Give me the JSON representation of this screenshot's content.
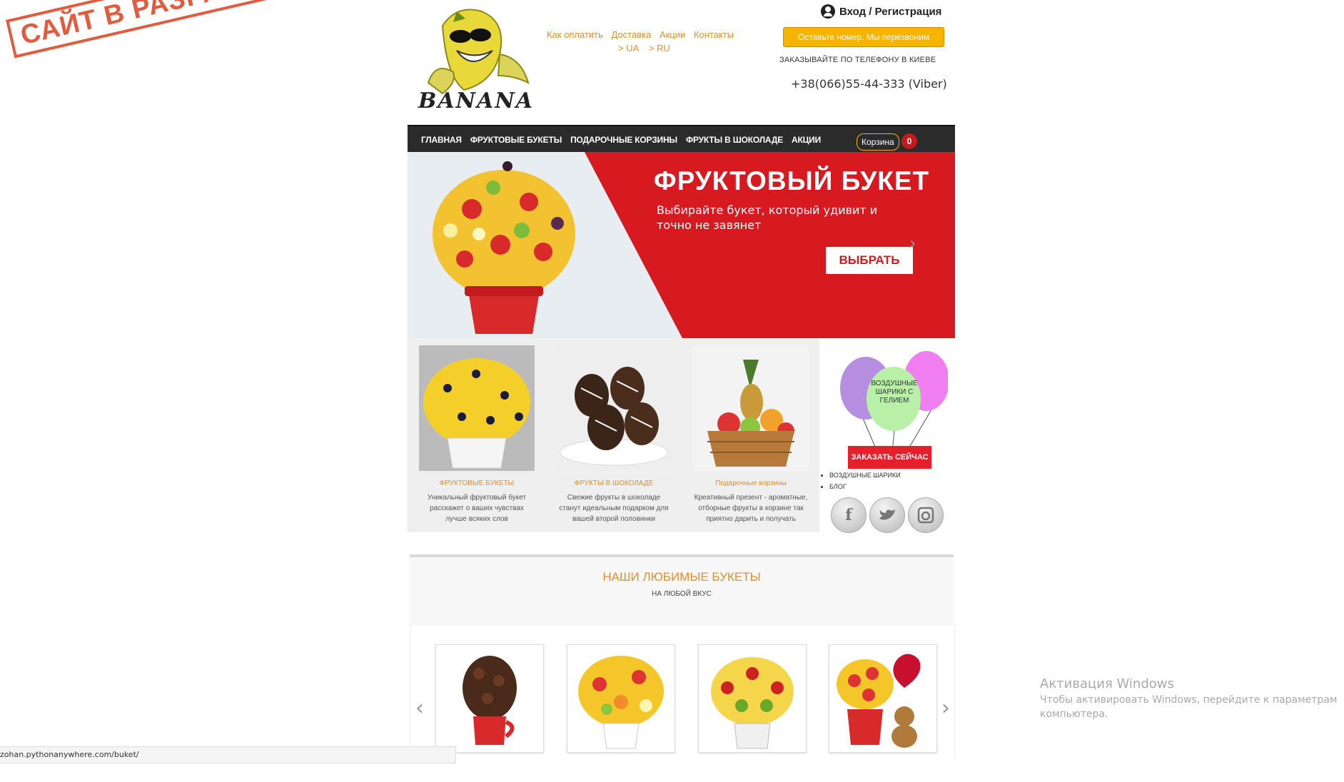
{
  "stamp": "САЙТ В РАЗРАБОТКЕ!",
  "logo": {
    "text": "BANANA"
  },
  "top_links": [
    "Как оплатить",
    "Доставка",
    "Акции",
    "Контакты"
  ],
  "lang_links": [
    "> UA",
    "> RU"
  ],
  "login": {
    "label": "Вход / Регистрация",
    "icon": "user-icon"
  },
  "callback_button": "Оставьте номер. Мы перезвоним",
  "phone_note": "ЗАКАЗЫВАЙТЕ ПО ТЕЛЕФОНУ В КИЕВЕ",
  "phone": "+38(066)55-44-333 (Viber)",
  "nav": {
    "items": [
      "ГЛАВНАЯ",
      "ФРУКТОВЫЕ БУКЕТЫ",
      "ПОДАРОЧНЫЕ КОРЗИНЫ",
      "ФРУКТЫ В ШОКОЛАДЕ",
      "АКЦИИ"
    ],
    "cart_label": "Корзина",
    "cart_count": "0"
  },
  "hero": {
    "title": "ФРУКТОВЫЙ БУКЕТ",
    "subtitle": "Выбирайте букет, который удивит и точно не завянет",
    "button": "ВЫБРАТЬ"
  },
  "categories": [
    {
      "title": "ФРУКТОВЫЕ БУКЕТЫ",
      "desc": "Уникальный фруктовый букет расскажет о ваших чувствах лучше всяких слов"
    },
    {
      "title": "ФРУКТЫ В ШОКОЛАДЕ",
      "desc": "Свежие фрукты в шоколаде станут идеальным подарком для вашей второй половинки"
    },
    {
      "title": "Подарочные корзины",
      "desc": "Креативный презент - ароматные, отборные фрукты в корзине так приятно дарить и получать"
    }
  ],
  "balloons": {
    "label": "ВОЗДУШНЫЕ ШАРИКИ С ГЕЛИЕМ",
    "order_button": "ЗАКАЗАТЬ СЕЙЧАС"
  },
  "side_list": [
    "ВОЗДУШНЫЕ ШАРИКИ",
    "БЛОГ"
  ],
  "social": [
    "facebook-icon",
    "twitter-icon",
    "instagram-icon"
  ],
  "favorites": {
    "title": "НАШИ ЛЮБИМЫЕ БУКЕТЫ",
    "subtitle": "НА ЛЮБОЙ ВКУС"
  },
  "windows_watermark": {
    "title": "Активация Windows",
    "text": "Чтобы активировать Windows, перейдите к параметрам компьютера."
  },
  "status_url": "zohan.pythonanywhere.com/buket/",
  "colors": {
    "accent": "#e0902a",
    "red": "#d71920",
    "nav": "#2b2b2b",
    "yellow": "#f4b400"
  }
}
